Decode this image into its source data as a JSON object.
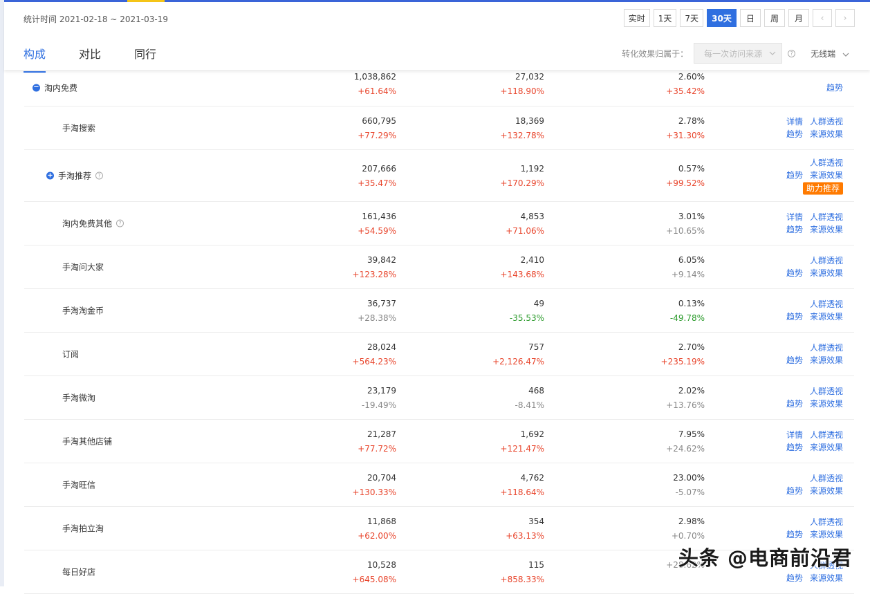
{
  "header": {
    "period": "统计时间 2021-02-18 ~ 2021-03-19",
    "period_buttons": [
      "实时",
      "1天",
      "7天",
      "30天",
      "日",
      "周",
      "月"
    ],
    "active_period": "30天",
    "prev_symbol": "‹",
    "next_symbol": "›",
    "tabs": [
      "构成",
      "对比",
      "同行"
    ],
    "active_tab": "构成",
    "attribution_label": "转化效果归属于：",
    "attribution_value": "每一次访问来源",
    "device": "无线端"
  },
  "rows": [
    {
      "name": "淘内免费",
      "control": "−",
      "v1": "1,038,862",
      "c1": "+61.64%",
      "v2": "27,032",
      "c2": "+118.90%",
      "v3": "2.60%",
      "c3": "+35.42%",
      "ops": [
        [
          "趋势"
        ]
      ],
      "badge": ""
    },
    {
      "name": "手淘搜索",
      "control": "",
      "v1": "660,795",
      "c1": "+77.29%",
      "v2": "18,369",
      "c2": "+132.78%",
      "v3": "2.78%",
      "c3": "+31.30%",
      "ops": [
        [
          "详情",
          "人群透视"
        ],
        [
          "趋势",
          "来源效果"
        ]
      ],
      "badge": ""
    },
    {
      "name": "手淘推荐",
      "control": "+",
      "help": true,
      "v1": "207,666",
      "c1": "+35.47%",
      "v2": "1,192",
      "c2": "+170.29%",
      "v3": "0.57%",
      "c3": "+99.52%",
      "ops": [
        [
          "人群透视"
        ],
        [
          "趋势",
          "来源效果"
        ]
      ],
      "badge": "助力推荐"
    },
    {
      "name": "淘内免费其他",
      "control": "",
      "help": true,
      "v1": "161,436",
      "c1": "+54.59%",
      "v2": "4,853",
      "c2": "+71.06%",
      "v3": "3.01%",
      "c3": "+10.65%",
      "ops": [
        [
          "详情",
          "人群透视"
        ],
        [
          "趋势",
          "来源效果"
        ]
      ],
      "badge": ""
    },
    {
      "name": "手淘问大家",
      "control": "",
      "v1": "39,842",
      "c1": "+123.28%",
      "v2": "2,410",
      "c2": "+143.68%",
      "v3": "6.05%",
      "c3": "+9.14%",
      "ops": [
        [
          "人群透视"
        ],
        [
          "趋势",
          "来源效果"
        ]
      ],
      "badge": ""
    },
    {
      "name": "手淘淘金币",
      "control": "",
      "v1": "36,737",
      "c1": "+28.38%",
      "v2": "49",
      "c2": "-35.53%",
      "v3": "0.13%",
      "c3": "-49.78%",
      "ops": [
        [
          "人群透视"
        ],
        [
          "趋势",
          "来源效果"
        ]
      ],
      "badge": ""
    },
    {
      "name": "订阅",
      "control": "",
      "v1": "28,024",
      "c1": "+564.23%",
      "v2": "757",
      "c2": "+2,126.47%",
      "v3": "2.70%",
      "c3": "+235.19%",
      "ops": [
        [
          "人群透视"
        ],
        [
          "趋势",
          "来源效果"
        ]
      ],
      "badge": ""
    },
    {
      "name": "手淘微淘",
      "control": "",
      "v1": "23,179",
      "c1": "-19.49%",
      "v2": "468",
      "c2": "-8.41%",
      "v3": "2.02%",
      "c3": "+13.76%",
      "ops": [
        [
          "人群透视"
        ],
        [
          "趋势",
          "来源效果"
        ]
      ],
      "badge": ""
    },
    {
      "name": "手淘其他店铺",
      "control": "",
      "v1": "21,287",
      "c1": "+77.72%",
      "v2": "1,692",
      "c2": "+121.47%",
      "v3": "7.95%",
      "c3": "+24.62%",
      "ops": [
        [
          "详情",
          "人群透视"
        ],
        [
          "趋势",
          "来源效果"
        ]
      ],
      "badge": ""
    },
    {
      "name": "手淘旺信",
      "control": "",
      "v1": "20,704",
      "c1": "+130.33%",
      "v2": "4,762",
      "c2": "+118.64%",
      "v3": "23.00%",
      "c3": "-5.07%",
      "ops": [
        [
          "人群透视"
        ],
        [
          "趋势",
          "来源效果"
        ]
      ],
      "badge": ""
    },
    {
      "name": "手淘拍立淘",
      "control": "",
      "v1": "11,868",
      "c1": "+62.00%",
      "v2": "354",
      "c2": "+63.13%",
      "v3": "2.98%",
      "c3": "+0.70%",
      "ops": [
        [
          "人群透视"
        ],
        [
          "趋势",
          "来源效果"
        ]
      ],
      "badge": ""
    },
    {
      "name": "每日好店",
      "control": "",
      "v1": "10,528",
      "c1": "+645.08%",
      "v2": "115",
      "c2": "+858.33%",
      "v3": "",
      "c3": "+28.62%",
      "ops": [
        [
          "人群透视"
        ],
        [
          "趋势",
          "来源效果"
        ]
      ],
      "badge": ""
    }
  ],
  "watermark": "头条 @电商前沿君",
  "colors": {
    "accent": "#2f6fe0",
    "up": "#e8442b",
    "down": "#2c9b2c",
    "neutral": "#888888",
    "badge": "#ff7a00"
  }
}
